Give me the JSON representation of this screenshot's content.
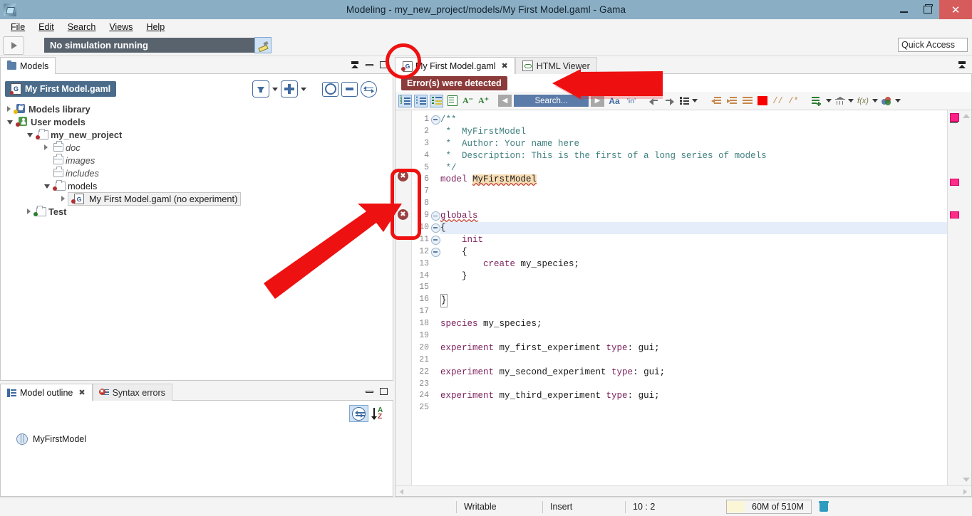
{
  "window": {
    "title": "Modeling - my_new_project/models/My First Model.gaml - Gama",
    "minimize_label": "–",
    "maximize_label": "❐",
    "close_label": "✕"
  },
  "menubar": {
    "items": [
      {
        "label": "File"
      },
      {
        "label": "Edit"
      },
      {
        "label": "Search"
      },
      {
        "label": "Views"
      },
      {
        "label": "Help"
      }
    ]
  },
  "toolbar": {
    "status_text": "No simulation running",
    "quick_access": "Quick Access"
  },
  "models_view": {
    "tab_label": "Models",
    "selected_model_chip": "My First Model.gaml",
    "chip_badge": "G",
    "tree": [
      {
        "label": "Models library",
        "indent": 0,
        "twist": "closed",
        "icon": "lock-icon",
        "dot": "y",
        "style": "bold"
      },
      {
        "label": "User models",
        "indent": 0,
        "twist": "open",
        "icon": "user-icon",
        "dot": "r",
        "style": "bold"
      },
      {
        "label": "my_new_project",
        "indent": 1,
        "twist": "open",
        "icon": "folder-icon",
        "dot": "r",
        "style": "bold"
      },
      {
        "label": "doc",
        "indent": 2,
        "twist": "closed",
        "icon": "case-icon",
        "dot": "",
        "style": "italic"
      },
      {
        "label": "images",
        "indent": 2,
        "twist": "none",
        "icon": "case-icon",
        "dot": "",
        "style": "italic"
      },
      {
        "label": "includes",
        "indent": 2,
        "twist": "none",
        "icon": "case-icon",
        "dot": "",
        "style": "italic"
      },
      {
        "label": "models",
        "indent": 2,
        "twist": "open",
        "icon": "folder-icon",
        "dot": "r",
        "style": "normal"
      },
      {
        "label": "My First Model.gaml (no experiment)",
        "indent": 3,
        "twist": "closed",
        "icon": "gaml-icon",
        "dot": "r",
        "style": "selected"
      },
      {
        "label": "Test",
        "indent": 1,
        "twist": "closed",
        "icon": "folder-icon",
        "dot": "g",
        "style": "bold"
      }
    ]
  },
  "outline_view": {
    "tabs": [
      {
        "label": "Model outline",
        "active": true,
        "icon": "outline-icon",
        "closable": true
      },
      {
        "label": "Syntax errors",
        "active": false,
        "icon": "syntax-errors-icon",
        "closable": false
      }
    ],
    "item": "MyFirstModel"
  },
  "editor": {
    "tabs": [
      {
        "label": "My First Model.gaml",
        "active": true,
        "icon": "gaml-file-icon",
        "closable": true
      },
      {
        "label": "HTML Viewer",
        "active": false,
        "icon": "html-viewer-icon",
        "closable": false
      }
    ],
    "error_banner": "Error(s) were detected",
    "toolbar_icons": [
      "numbered-list-icon",
      "bulleted-list-icon",
      "highlight-list-icon",
      "document-icon",
      "decrease-font-icon",
      "increase-font-icon",
      "search-prev-icon",
      "search-next-icon",
      "match-case-icon",
      "whole-word-icon",
      "back-icon",
      "forward-icon",
      "outline-dropdown-icon",
      "outdent-icon",
      "indent-icon",
      "format-icon",
      "color-icon",
      "line-comment-icon",
      "block-comment-icon",
      "new-template-icon",
      "library-icon",
      "function-icon",
      "theme-icon"
    ],
    "search_placeholder": "Search...",
    "lines": [
      {
        "n": 1,
        "fold": "collapse",
        "text": "/**",
        "cls": "cmt"
      },
      {
        "n": 2,
        "fold": "",
        "text": " *  MyFirstModel",
        "cls": "cmt"
      },
      {
        "n": 3,
        "fold": "",
        "text": " *  Author: Your name here",
        "cls": "cmt"
      },
      {
        "n": 4,
        "fold": "",
        "text": " *  Description: This is the first of a long series of models",
        "cls": "cmt"
      },
      {
        "n": 5,
        "fold": "",
        "text": " */",
        "cls": "cmt"
      },
      {
        "n": 6,
        "fold": "",
        "text": "model MyFirstModel",
        "cls": "code-model",
        "marker": "error"
      },
      {
        "n": 7,
        "fold": "",
        "text": "",
        "cls": ""
      },
      {
        "n": 8,
        "fold": "",
        "text": "",
        "cls": ""
      },
      {
        "n": 9,
        "fold": "collapse",
        "text": "globals",
        "cls": "code-globals",
        "marker": "error"
      },
      {
        "n": 10,
        "fold": "collapse",
        "text": "{",
        "cls": "",
        "highlight": true
      },
      {
        "n": 11,
        "fold": "collapse",
        "text": "    init",
        "cls": "code-init"
      },
      {
        "n": 12,
        "fold": "collapse",
        "text": "    {",
        "cls": ""
      },
      {
        "n": 13,
        "fold": "",
        "text": "        create my_species;",
        "cls": "code-create"
      },
      {
        "n": 14,
        "fold": "",
        "text": "    }",
        "cls": ""
      },
      {
        "n": 15,
        "fold": "",
        "text": "",
        "cls": ""
      },
      {
        "n": 16,
        "fold": "",
        "text": "}",
        "cls": "cursor"
      },
      {
        "n": 17,
        "fold": "",
        "text": "",
        "cls": ""
      },
      {
        "n": 18,
        "fold": "",
        "text": "species my_species;",
        "cls": "code-species"
      },
      {
        "n": 19,
        "fold": "",
        "text": "",
        "cls": ""
      },
      {
        "n": 20,
        "fold": "",
        "text": "experiment my_first_experiment type: gui;",
        "cls": "code-exp"
      },
      {
        "n": 21,
        "fold": "",
        "text": "",
        "cls": ""
      },
      {
        "n": 22,
        "fold": "",
        "text": "experiment my_second_experiment type: gui;",
        "cls": "code-exp"
      },
      {
        "n": 23,
        "fold": "",
        "text": "",
        "cls": ""
      },
      {
        "n": 24,
        "fold": "",
        "text": "experiment my_third_experiment type: gui;",
        "cls": "code-exp"
      },
      {
        "n": 25,
        "fold": "",
        "text": "",
        "cls": ""
      }
    ]
  },
  "statusbar": {
    "writable": "Writable",
    "insert": "Insert",
    "position": "10 : 2",
    "heap": "60M of 510M"
  },
  "colors": {
    "titlebar": "#8aaec4",
    "close_button": "#d65b5b",
    "status_pill": "#59636e",
    "error_banner": "#8c3b3b",
    "annotation_red": "#ee1111",
    "accent_blue": "#4a6b8a",
    "comment_green": "#3f7f7f",
    "keyword_purple": "#7b1f5c",
    "marker_pink": "#ff2d8a"
  }
}
